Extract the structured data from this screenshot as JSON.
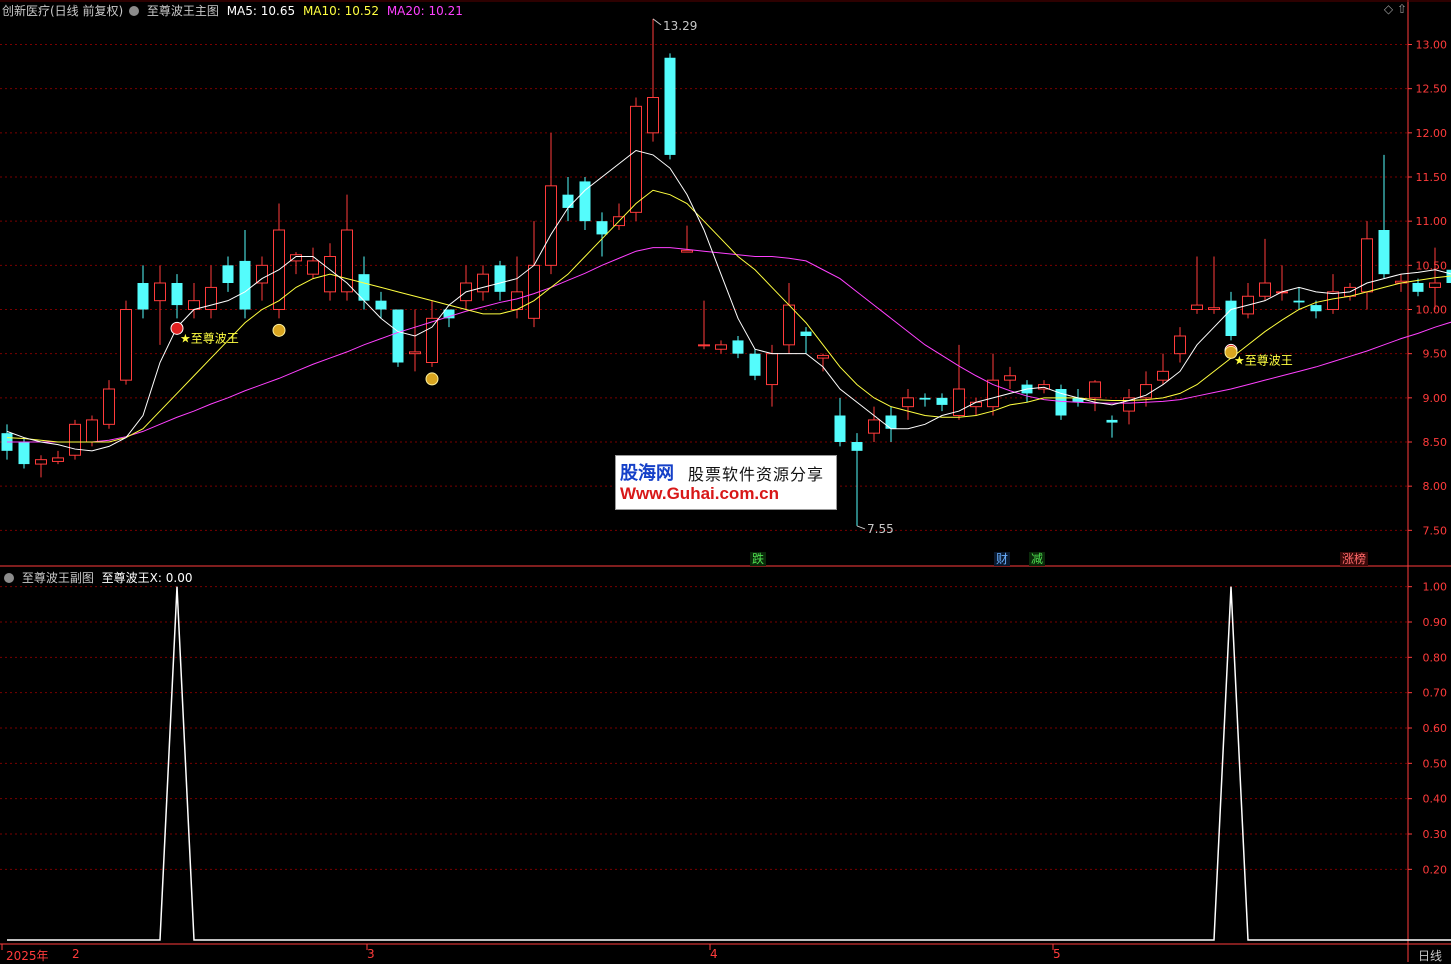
{
  "main_header": {
    "title": "创新医疗(日线 前复权)",
    "indicator": "至尊波王主图",
    "ma5_label": "MA5: 10.65",
    "ma10_label": "MA10: 10.52",
    "ma20_label": "MA20: 10.21"
  },
  "sub_header": {
    "indicator": "至尊波王副图",
    "value_label": "至尊波王X: 0.00"
  },
  "colors": {
    "up": "#ff3b3b",
    "down": "#54fcfc",
    "ma5": "#ffffff",
    "ma10": "#ffff40",
    "ma20": "#ff40ff",
    "grid": "#7a0000",
    "axis_text": "#ff3b3b"
  },
  "signal_label": "★至尊波王",
  "max_label": "13.29",
  "min_label": "7.55",
  "markers": [
    "跌",
    "财",
    "减",
    "涨榜"
  ],
  "time_labels": [
    "2025年",
    "2",
    "3",
    "4",
    "5"
  ],
  "period_label": "日线",
  "watermark": {
    "brand": "股海网",
    "slogan": "股票软件资源分享",
    "url": "Www.Guhai.com.cn"
  },
  "chart_data": [
    {
      "type": "candlestick",
      "title": "至尊波王主图",
      "ylim": [
        7.3,
        13.3
      ],
      "y_ticks": [
        7.5,
        8.0,
        8.5,
        9.0,
        9.5,
        10.0,
        10.5,
        11.0,
        11.5,
        12.0,
        12.5,
        13.0
      ],
      "candles": [
        [
          8.6,
          8.4,
          8.7,
          8.3
        ],
        [
          8.5,
          8.25,
          8.55,
          8.2
        ],
        [
          8.25,
          8.3,
          8.35,
          8.1
        ],
        [
          8.28,
          8.32,
          8.4,
          8.25
        ],
        [
          8.35,
          8.7,
          8.75,
          8.3
        ],
        [
          8.5,
          8.75,
          8.8,
          8.45
        ],
        [
          8.7,
          9.1,
          9.2,
          8.65
        ],
        [
          9.2,
          10.0,
          10.1,
          9.15
        ],
        [
          10.3,
          10.0,
          10.5,
          9.9
        ],
        [
          10.1,
          10.3,
          10.5,
          9.6
        ],
        [
          10.3,
          10.05,
          10.4,
          9.9
        ],
        [
          10.0,
          10.1,
          10.3,
          9.9
        ],
        [
          10.0,
          10.25,
          10.5,
          9.9
        ],
        [
          10.5,
          10.3,
          10.6,
          10.2
        ],
        [
          10.55,
          10.0,
          10.9,
          9.9
        ],
        [
          10.3,
          10.5,
          10.6,
          10.1
        ],
        [
          10.0,
          10.9,
          11.2,
          9.9
        ],
        [
          10.55,
          10.62,
          10.65,
          10.4
        ],
        [
          10.4,
          10.55,
          10.7,
          10.35
        ],
        [
          10.2,
          10.6,
          10.75,
          10.1
        ],
        [
          10.2,
          10.9,
          11.3,
          10.1
        ],
        [
          10.4,
          10.1,
          10.6,
          10.0
        ],
        [
          10.1,
          10.0,
          10.2,
          9.9
        ],
        [
          10.0,
          9.4,
          10.0,
          9.35
        ],
        [
          9.5,
          9.52,
          10.0,
          9.3
        ],
        [
          9.4,
          9.9,
          10.1,
          9.35
        ],
        [
          10.0,
          9.9,
          10.0,
          9.8
        ],
        [
          10.1,
          10.3,
          10.5,
          10.0
        ],
        [
          10.2,
          10.4,
          10.5,
          10.1
        ],
        [
          10.5,
          10.2,
          10.55,
          10.1
        ],
        [
          10.0,
          10.2,
          10.6,
          9.9
        ],
        [
          9.9,
          10.5,
          11.0,
          9.8
        ],
        [
          10.5,
          11.4,
          12.0,
          10.4
        ],
        [
          11.3,
          11.15,
          11.5,
          11.0
        ],
        [
          11.45,
          11.0,
          11.5,
          10.9
        ],
        [
          11.0,
          10.85,
          11.1,
          10.6
        ],
        [
          10.95,
          11.05,
          11.2,
          10.9
        ],
        [
          11.1,
          12.3,
          12.4,
          11.0
        ],
        [
          12.0,
          12.4,
          13.29,
          11.9
        ],
        [
          12.85,
          11.75,
          12.9,
          11.7
        ],
        [
          10.65,
          10.67,
          10.95,
          10.65
        ],
        [
          9.6,
          9.6,
          10.1,
          9.55
        ],
        [
          9.55,
          9.6,
          9.65,
          9.5
        ],
        [
          9.65,
          9.5,
          9.7,
          9.45
        ],
        [
          9.5,
          9.25,
          9.55,
          9.2
        ],
        [
          9.15,
          9.5,
          9.6,
          8.9
        ],
        [
          9.6,
          10.05,
          10.3,
          9.5
        ],
        [
          9.75,
          9.7,
          9.8,
          9.5
        ],
        [
          9.45,
          9.48,
          9.5,
          9.3
        ],
        [
          8.8,
          8.5,
          9.0,
          8.45
        ],
        [
          8.5,
          8.4,
          8.6,
          7.55
        ],
        [
          8.6,
          8.75,
          8.9,
          8.5
        ],
        [
          8.8,
          8.65,
          8.9,
          8.5
        ],
        [
          8.9,
          9.0,
          9.1,
          8.75
        ],
        [
          9.0,
          8.98,
          9.05,
          8.9
        ],
        [
          9.0,
          8.92,
          9.05,
          8.85
        ],
        [
          8.8,
          9.1,
          9.6,
          8.75
        ],
        [
          8.9,
          8.95,
          9.0,
          8.8
        ],
        [
          8.9,
          9.2,
          9.5,
          8.8
        ],
        [
          9.2,
          9.25,
          9.35,
          9.1
        ],
        [
          9.15,
          9.05,
          9.2,
          8.95
        ],
        [
          9.1,
          9.15,
          9.2,
          9.05
        ],
        [
          9.1,
          8.8,
          9.15,
          8.75
        ],
        [
          9.0,
          8.95,
          9.1,
          8.9
        ],
        [
          9.0,
          9.18,
          9.2,
          8.85
        ],
        [
          8.75,
          8.72,
          8.8,
          8.55
        ],
        [
          8.85,
          9.0,
          9.1,
          8.7
        ],
        [
          9.0,
          9.15,
          9.3,
          8.9
        ],
        [
          9.2,
          9.3,
          9.5,
          9.15
        ],
        [
          9.5,
          9.7,
          9.8,
          9.4
        ],
        [
          10.0,
          10.05,
          10.6,
          9.95
        ],
        [
          10.0,
          10.02,
          10.6,
          9.95
        ],
        [
          10.1,
          9.7,
          10.2,
          9.65
        ],
        [
          9.95,
          10.15,
          10.3,
          9.9
        ],
        [
          10.15,
          10.3,
          10.8,
          10.1
        ],
        [
          10.2,
          10.2,
          10.5,
          10.1
        ],
        [
          10.1,
          10.08,
          10.25,
          10.0
        ],
        [
          10.05,
          9.98,
          10.1,
          9.9
        ],
        [
          10.0,
          10.2,
          10.4,
          9.95
        ],
        [
          10.15,
          10.25,
          10.3,
          10.1
        ],
        [
          10.2,
          10.8,
          11.0,
          10.0
        ],
        [
          10.9,
          10.4,
          11.75,
          10.35
        ],
        [
          10.3,
          10.32,
          10.4,
          10.2
        ],
        [
          10.3,
          10.2,
          10.35,
          10.15
        ],
        [
          10.25,
          10.3,
          10.7,
          10.0
        ],
        [
          10.45,
          10.3,
          10.5,
          10.2
        ],
        [
          10.4,
          10.25,
          10.5,
          10.2
        ],
        [
          10.25,
          10.28,
          10.3,
          10.15
        ],
        [
          10.3,
          10.55,
          10.65,
          10.2
        ],
        [
          10.3,
          11.6,
          11.6,
          10.3
        ]
      ],
      "ma5": [
        8.62,
        8.55,
        8.5,
        8.47,
        8.42,
        8.4,
        8.45,
        8.55,
        8.8,
        9.4,
        9.8,
        10.0,
        10.05,
        10.1,
        10.2,
        10.35,
        10.45,
        10.6,
        10.6,
        10.45,
        10.3,
        10.1,
        9.9,
        9.75,
        9.7,
        9.8,
        10.05,
        10.2,
        10.25,
        10.3,
        10.35,
        10.5,
        10.85,
        11.15,
        11.35,
        11.5,
        11.65,
        11.8,
        11.75,
        11.6,
        11.3,
        10.9,
        10.4,
        9.9,
        9.55,
        9.5,
        9.5,
        9.5,
        9.35,
        9.1,
        8.95,
        8.8,
        8.65,
        8.65,
        8.7,
        8.8,
        8.85,
        8.95,
        9.0,
        9.05,
        9.1,
        9.12,
        9.05,
        9.0,
        8.95,
        8.92,
        8.97,
        9.03,
        9.15,
        9.3,
        9.6,
        9.8,
        10.0,
        10.05,
        10.1,
        10.2,
        10.25,
        10.2,
        10.18,
        10.2,
        10.3,
        10.35,
        10.4,
        10.42,
        10.45,
        10.4,
        10.35,
        10.3,
        10.38,
        10.6
      ],
      "ma10": [
        8.55,
        8.54,
        8.52,
        8.5,
        8.5,
        8.5,
        8.5,
        8.55,
        8.65,
        8.85,
        9.05,
        9.25,
        9.45,
        9.65,
        9.85,
        10.0,
        10.1,
        10.25,
        10.35,
        10.4,
        10.35,
        10.3,
        10.25,
        10.2,
        10.15,
        10.1,
        10.05,
        10.0,
        9.95,
        9.95,
        10.0,
        10.1,
        10.25,
        10.4,
        10.6,
        10.8,
        11.0,
        11.2,
        11.35,
        11.3,
        11.2,
        11.0,
        10.8,
        10.6,
        10.45,
        10.25,
        10.05,
        9.85,
        9.6,
        9.35,
        9.15,
        9.0,
        8.9,
        8.85,
        8.8,
        8.78,
        8.78,
        8.8,
        8.85,
        8.92,
        8.95,
        9.0,
        9.0,
        9.0,
        8.98,
        8.97,
        8.97,
        8.98,
        9.0,
        9.05,
        9.15,
        9.3,
        9.45,
        9.6,
        9.75,
        9.88,
        10.0,
        10.08,
        10.12,
        10.15,
        10.2,
        10.25,
        10.3,
        10.33,
        10.36,
        10.38,
        10.4,
        10.38,
        10.38,
        10.52
      ],
      "ma20": [
        8.5,
        8.5,
        8.5,
        8.5,
        8.5,
        8.5,
        8.52,
        8.56,
        8.62,
        8.7,
        8.78,
        8.85,
        8.93,
        9.0,
        9.08,
        9.15,
        9.22,
        9.3,
        9.38,
        9.45,
        9.52,
        9.6,
        9.67,
        9.74,
        9.8,
        9.86,
        9.92,
        9.98,
        10.03,
        10.08,
        10.12,
        10.18,
        10.25,
        10.33,
        10.41,
        10.5,
        10.58,
        10.66,
        10.7,
        10.7,
        10.68,
        10.66,
        10.64,
        10.62,
        10.6,
        10.6,
        10.58,
        10.55,
        10.45,
        10.35,
        10.2,
        10.05,
        9.9,
        9.75,
        9.6,
        9.48,
        9.36,
        9.25,
        9.15,
        9.08,
        9.02,
        8.98,
        8.96,
        8.95,
        8.94,
        8.94,
        8.94,
        8.95,
        8.96,
        8.98,
        9.02,
        9.06,
        9.1,
        9.15,
        9.2,
        9.25,
        9.3,
        9.35,
        9.41,
        9.47,
        9.53,
        9.6,
        9.67,
        9.73,
        9.8,
        9.86,
        9.92,
        10.0,
        10.08,
        10.21
      ],
      "signals": [
        10,
        72
      ],
      "annotations": [
        "13.29",
        "7.55",
        "★至尊波王"
      ]
    },
    {
      "type": "line",
      "title": "至尊波王副图",
      "series": [
        {
          "name": "至尊波王X",
          "x_pulse_bars": [
            10,
            72
          ],
          "values_at_pulse": 1.0,
          "baseline": 0.0
        }
      ],
      "ylim": [
        0,
        1.05
      ],
      "y_ticks": [
        0.2,
        0.3,
        0.4,
        0.5,
        0.6,
        0.7,
        0.8,
        0.9,
        1.0
      ]
    }
  ]
}
